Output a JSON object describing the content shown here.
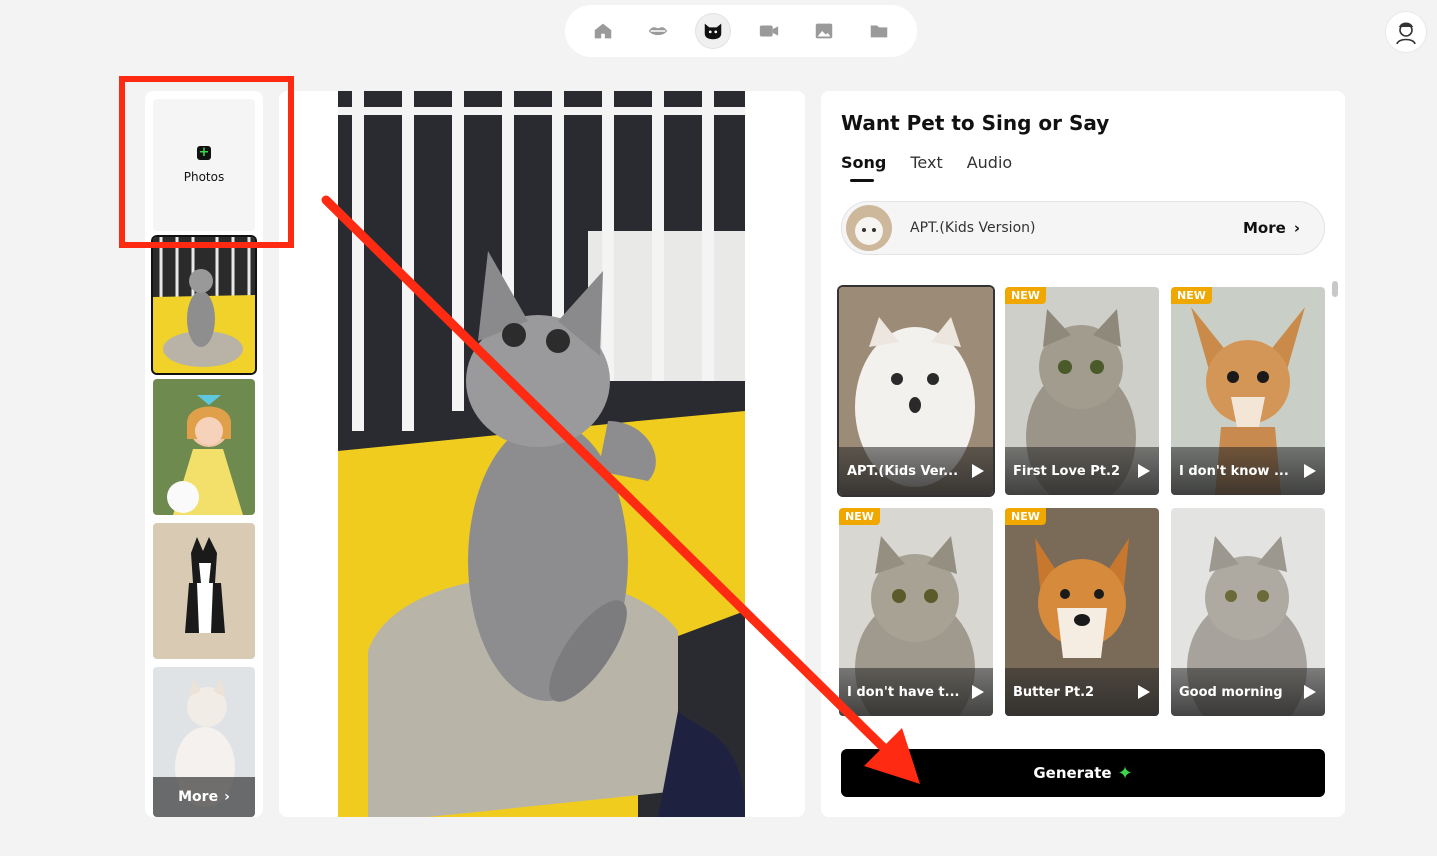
{
  "nav": {
    "items": [
      {
        "name": "home",
        "icon": "home-icon"
      },
      {
        "name": "lips",
        "icon": "lips-icon"
      },
      {
        "name": "pet",
        "icon": "cat-icon",
        "active": true
      },
      {
        "name": "video",
        "icon": "video-camera-icon"
      },
      {
        "name": "image",
        "icon": "image-icon"
      },
      {
        "name": "folder",
        "icon": "folder-icon"
      }
    ]
  },
  "left": {
    "upload_label": "Photos",
    "more_label": "More"
  },
  "panel": {
    "title": "Want Pet to Sing or Say",
    "tabs": [
      "Song",
      "Text",
      "Audio"
    ],
    "active_tab": "Song",
    "song": {
      "name": "APT.(Kids Version)",
      "more": "More"
    },
    "cards": [
      {
        "label": "APT.(Kids Ver...",
        "new": false,
        "selected": true
      },
      {
        "label": "First Love Pt.2",
        "new": true
      },
      {
        "label": "I don't know ...",
        "new": true
      },
      {
        "label": "I don't have t...",
        "new": true
      },
      {
        "label": "Butter Pt.2",
        "new": true
      },
      {
        "label": "Good morning",
        "new": false
      }
    ],
    "new_badge": "NEW",
    "generate_label": "Generate"
  },
  "colors": {
    "accent_green": "#3bd64a",
    "badge": "#f0a800",
    "annotation": "#ff2a12"
  }
}
